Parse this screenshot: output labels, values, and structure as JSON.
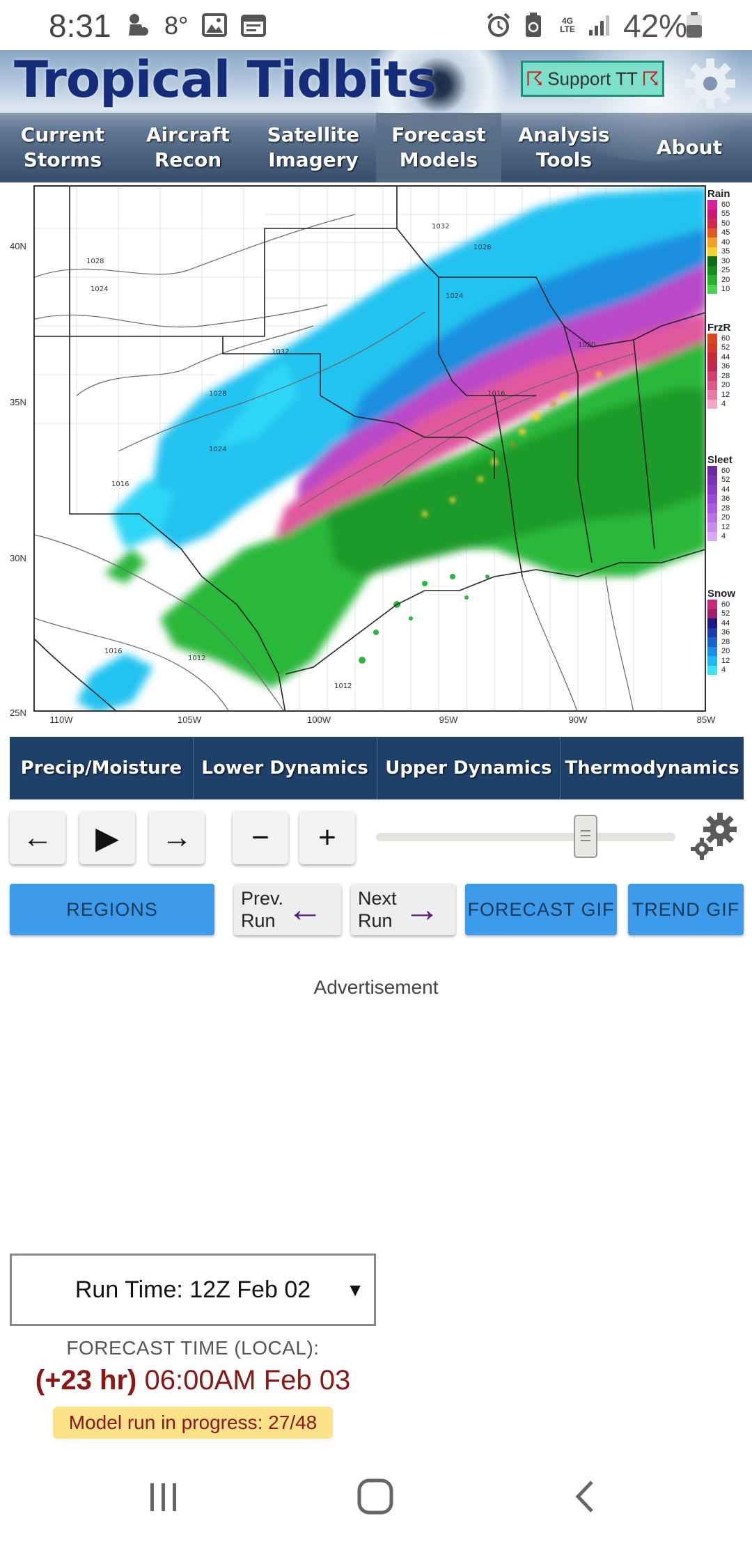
{
  "status_bar": {
    "time": "8:31",
    "temperature": "8°",
    "network": "4G LTE",
    "battery": "42%",
    "icons": [
      "fan-notification-icon",
      "image-icon",
      "calendar-icon",
      "alarm-icon",
      "battery-saver-icon",
      "signal-icon",
      "battery-icon"
    ]
  },
  "header": {
    "logo": "Tropical Tidbits",
    "support_button": "Support TT",
    "nav": [
      "Current Storms",
      "Aircraft Recon",
      "Satellite Imagery",
      "Forecast Models",
      "Analysis Tools",
      "About"
    ],
    "active_nav": "Forecast Models"
  },
  "map": {
    "lat_labels": [
      "40N",
      "35N",
      "30N",
      "25N"
    ],
    "lon_labels": [
      "110W",
      "105W",
      "100W",
      "95W",
      "90W",
      "85W"
    ],
    "isobar_labels": [
      "1028",
      "1024",
      "1032",
      "1028",
      "1024",
      "1016",
      "1012",
      "1016",
      "1012",
      "1032",
      "1028",
      "1024",
      "1020",
      "1016"
    ],
    "legends": [
      {
        "title": "Rain",
        "values": [
          "60",
          "55",
          "50",
          "45",
          "40",
          "35",
          "30",
          "25",
          "20",
          "10"
        ],
        "colors": [
          "#e01c9c",
          "#c81874",
          "#d2284c",
          "#e05a28",
          "#f0a028",
          "#f4d030",
          "#0a6e1a",
          "#188c20",
          "#28b030",
          "#50d050"
        ]
      },
      {
        "title": "FrzR",
        "values": [
          "60",
          "52",
          "44",
          "36",
          "28",
          "20",
          "12",
          "4"
        ],
        "colors": [
          "#d84818",
          "#d83828",
          "#c82838",
          "#c02a50",
          "#d0406e",
          "#dc5a8a",
          "#e87aa6",
          "#f2a8c8"
        ]
      },
      {
        "title": "Sleet",
        "values": [
          "60",
          "52",
          "44",
          "36",
          "28",
          "20",
          "12",
          "4"
        ],
        "colors": [
          "#6c2aa0",
          "#7a32b4",
          "#8a3cc8",
          "#9a48d8",
          "#a85ae0",
          "#b872e6",
          "#c88cee",
          "#d8aaf4"
        ]
      },
      {
        "title": "Snow",
        "values": [
          "60",
          "52",
          "44",
          "36",
          "28",
          "20",
          "12",
          "4"
        ],
        "colors": [
          "#c8287a",
          "#a0206c",
          "#201880",
          "#1c3aa8",
          "#1a62d0",
          "#1a90e6",
          "#20b8f0",
          "#40e0f8"
        ]
      }
    ]
  },
  "categories": [
    "Precip/Moisture",
    "Lower Dynamics",
    "Upper Dynamics",
    "Thermodynamics"
  ],
  "controls": {
    "prev_label": "←",
    "play_label": "▶",
    "next_label": "→",
    "minus_label": "−",
    "plus_label": "+",
    "slider_position": 0.7
  },
  "buttons": {
    "regions": "REGIONS",
    "prev_run": "Prev. Run",
    "next_run": "Next Run",
    "forecast_gif": "FORECAST GIF",
    "trend_gif": "TREND GIF"
  },
  "ad": {
    "label": "Advertisement"
  },
  "run": {
    "run_time": "Run Time: 12Z Feb 02",
    "forecast_label": "FORECAST TIME (LOCAL):",
    "forecast_hr": "(+23 hr)",
    "forecast_date": "06:00AM Feb 03",
    "progress": "Model run in progress: 27/48"
  }
}
